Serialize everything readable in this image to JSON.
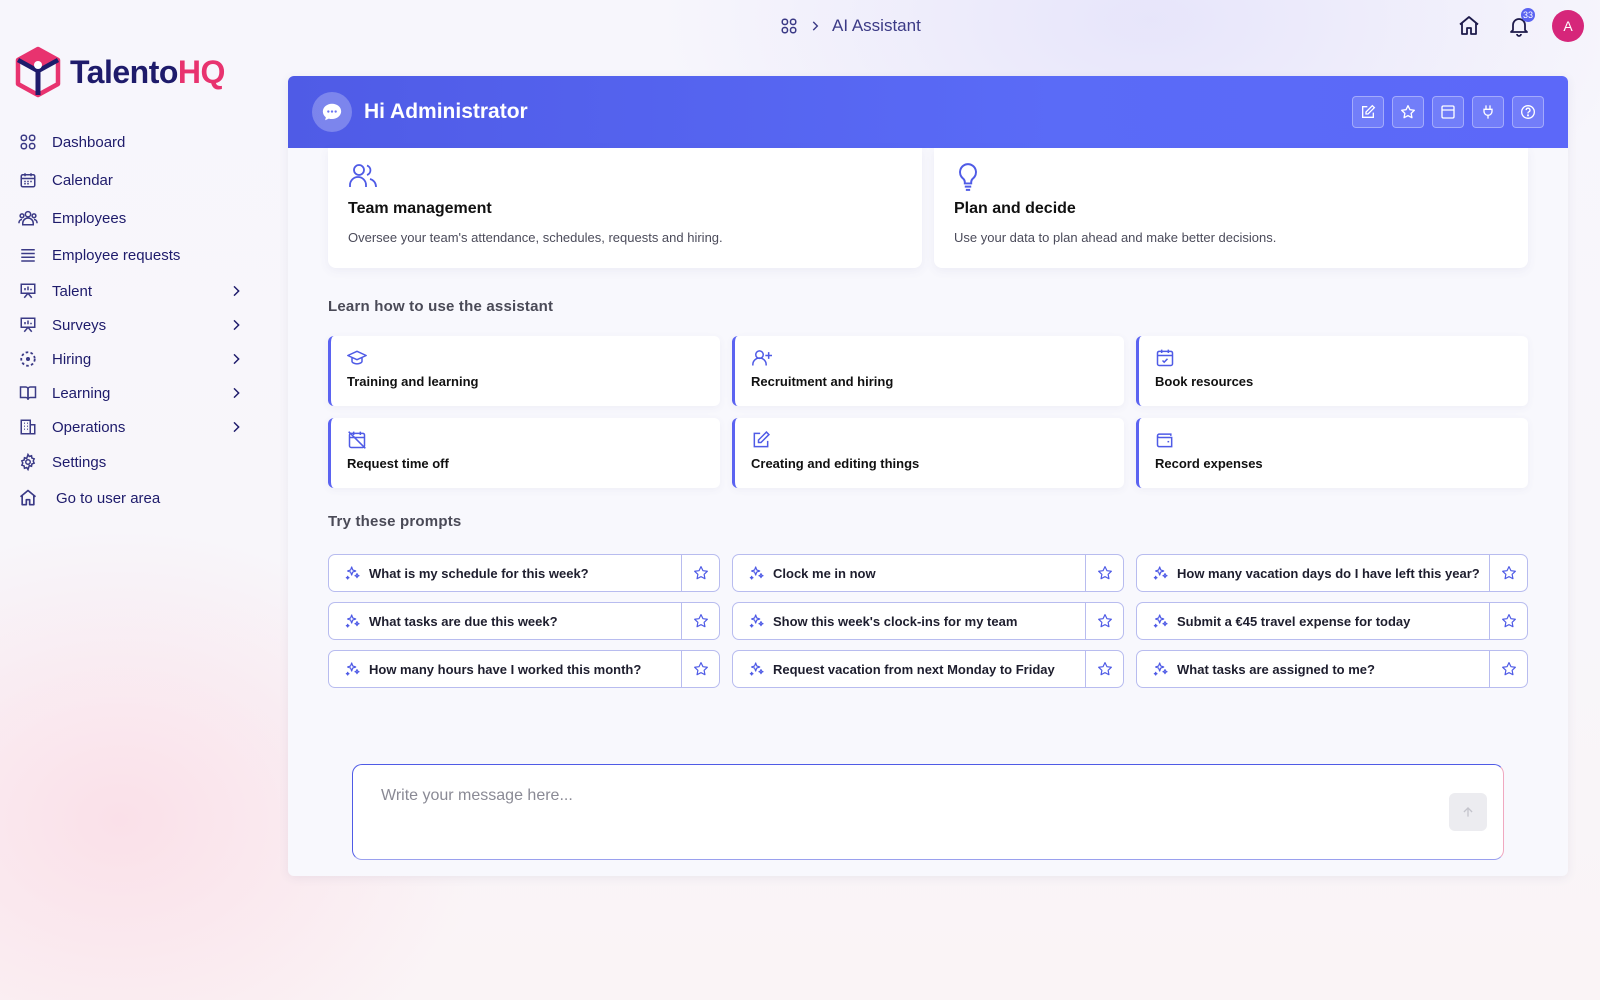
{
  "breadcrumb": {
    "current": "AI Assistant"
  },
  "top": {
    "notification_count": "33",
    "avatar_initial": "A"
  },
  "brand": {
    "name_part1": "Talento",
    "name_part2": "HQ"
  },
  "sidebar": {
    "items": [
      {
        "label": "Dashboard",
        "icon": "grid-icon"
      },
      {
        "label": "Calendar",
        "icon": "calendar-icon"
      },
      {
        "label": "Employees",
        "icon": "users-icon"
      },
      {
        "label": "Employee requests",
        "icon": "list-icon"
      },
      {
        "label": "Talent",
        "icon": "presentation-icon",
        "expandable": true
      },
      {
        "label": "Surveys",
        "icon": "presentation-icon",
        "expandable": true
      },
      {
        "label": "Hiring",
        "icon": "dashed-circle-icon",
        "expandable": true
      },
      {
        "label": "Learning",
        "icon": "book-icon",
        "expandable": true
      },
      {
        "label": "Operations",
        "icon": "building-icon",
        "expandable": true
      },
      {
        "label": "Settings",
        "icon": "gear-icon"
      },
      {
        "label": "Go to user area",
        "icon": "home-icon"
      }
    ]
  },
  "assistant": {
    "greeting": "Hi Administrator",
    "features": [
      {
        "title": "Team management",
        "description": "Oversee your team's attendance, schedules, requests and hiring.",
        "icon": "team-icon"
      },
      {
        "title": "Plan and decide",
        "description": "Use your data to plan ahead and make better decisions.",
        "icon": "lightbulb-icon"
      }
    ],
    "learn_title": "Learn how to use the assistant",
    "learn_cards": [
      {
        "label": "Training and learning",
        "icon": "graduation-cap-icon"
      },
      {
        "label": "Recruitment and hiring",
        "icon": "user-plus-icon"
      },
      {
        "label": "Book resources",
        "icon": "calendar-check-icon"
      },
      {
        "label": "Request time off",
        "icon": "calendar-off-icon"
      },
      {
        "label": "Creating and editing things",
        "icon": "edit-icon"
      },
      {
        "label": "Record expenses",
        "icon": "wallet-icon"
      }
    ],
    "prompts_title": "Try these prompts",
    "prompts": [
      "What is my schedule for this week?",
      "Clock me in now",
      "How many vacation days do I have left this year?",
      "What tasks are due this week?",
      "Show this week's clock-ins for my team",
      "Submit a €45 travel expense for today",
      "How many hours have I worked this month?",
      "Request vacation from next Monday to Friday",
      "What tasks are assigned to me?"
    ],
    "composer_placeholder": "Write your message here..."
  },
  "colors": {
    "accent": "#5b63f1",
    "brand_navy": "#1e1b6b",
    "brand_pink": "#e8336f"
  }
}
